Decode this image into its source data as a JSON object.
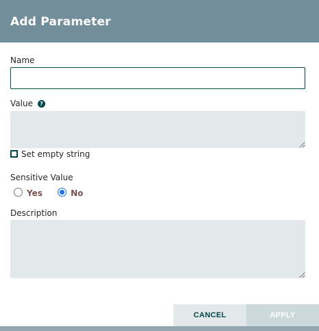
{
  "dialog": {
    "title": "Add Parameter"
  },
  "fields": {
    "name_label": "Name",
    "name_value": "",
    "value_label": "Value",
    "help_icon_glyph": "?",
    "value_text": "",
    "empty_string_label": "Set empty string",
    "empty_string_checked": false,
    "sensitive_label": "Sensitive Value",
    "sensitive_yes_label": "Yes",
    "sensitive_no_label": "No",
    "sensitive_selected": "No",
    "description_label": "Description",
    "description_text": ""
  },
  "actions": {
    "cancel_label": "CANCEL",
    "apply_label": "APPLY",
    "apply_enabled": false
  },
  "colors": {
    "header": "#728e9b",
    "accent": "#004849",
    "field_bg": "#e3e8eb",
    "radio_label": "#775351"
  },
  "icons": {
    "help": "help-circle-icon"
  }
}
